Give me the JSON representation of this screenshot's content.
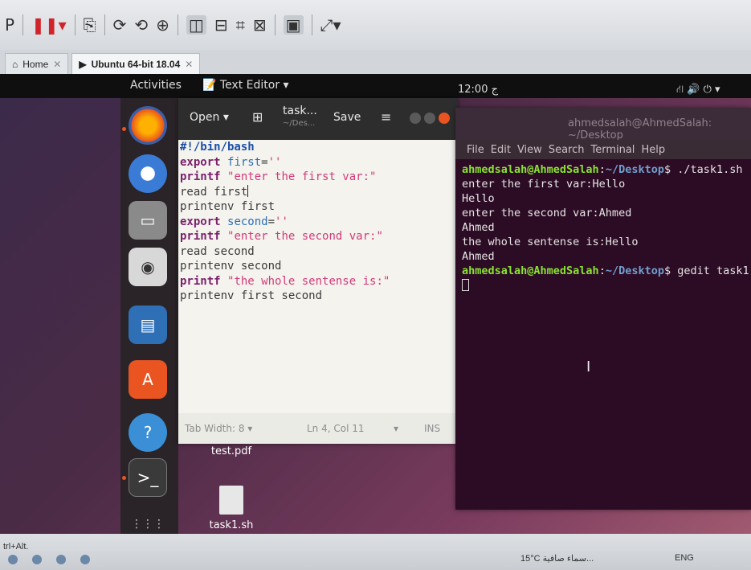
{
  "vm_tabs": {
    "home_label": "Home",
    "vm_label": "Ubuntu 64-bit 18.04"
  },
  "topbar": {
    "activities": "Activities",
    "app_menu": "Text Editor ▾",
    "clock": "12:00 ج"
  },
  "gedit": {
    "open_label": "Open",
    "title": "task...",
    "subtitle": "~/Des...",
    "save_label": "Save",
    "lines": [
      "#!/bin/bash",
      "export first=''",
      "printf \"enter the first var:\"",
      "read first",
      "printenv first",
      "export second=''",
      "printf \"enter the second var:\"",
      "read second",
      "printenv second",
      "printf \"the whole sentense is:\"",
      "printenv first second"
    ],
    "status": {
      "tab_width": "Tab Width: 8 ▾",
      "position": "Ln 4, Col 11",
      "ins": "INS"
    }
  },
  "desktop_files": [
    {
      "name": "test.pdf"
    },
    {
      "name": "task1.sh"
    }
  ],
  "terminal": {
    "title": "ahmedsalah@AhmedSalah: ~/Desktop",
    "menu": [
      "File",
      "Edit",
      "View",
      "Search",
      "Terminal",
      "Help"
    ],
    "prompt_user": "ahmedsalah@AhmedSalah",
    "prompt_path": "~/Desktop",
    "cmd1": "$ ./task1.sh",
    "output": [
      "enter the first var:Hello",
      "Hello",
      "enter the second var:Ahmed",
      "Ahmed",
      "the whole sentense is:Hello",
      "Ahmed"
    ],
    "cmd2": "$ gedit task1.sh"
  },
  "host": {
    "ctrl_alt": "trl+Alt.",
    "weather": "15°C  سماء صافية...",
    "tray": "ENG"
  },
  "colors": {
    "accent": "#e95420",
    "terminal_bg": "#2c0c24",
    "prompt_user": "#8ae234",
    "prompt_path": "#729fcf"
  }
}
